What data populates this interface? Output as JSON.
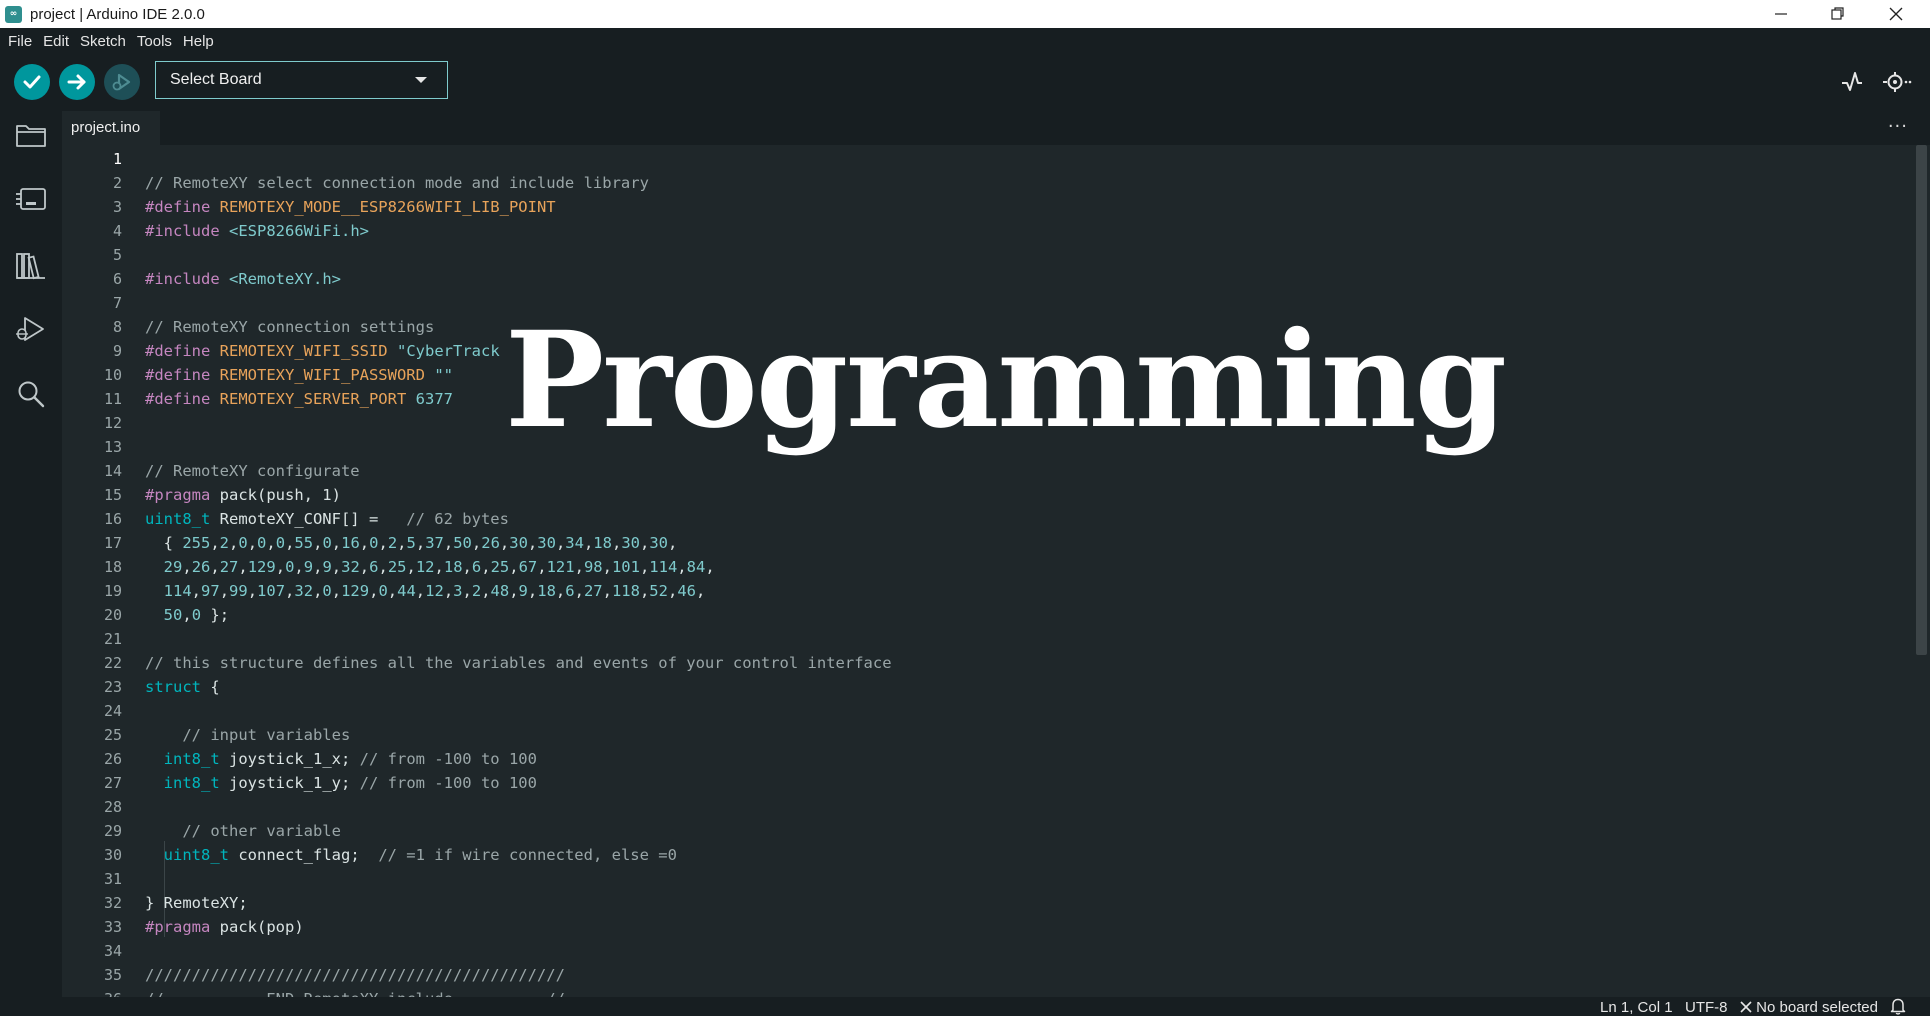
{
  "window": {
    "title": "project | Arduino IDE 2.0.0",
    "app_icon": "∞"
  },
  "menu": [
    "File",
    "Edit",
    "Sketch",
    "Tools",
    "Help"
  ],
  "toolbar": {
    "board_select_label": "Select Board",
    "verify_icon": "check-icon",
    "upload_icon": "arrow-right-icon",
    "debug_icon": "debug-icon",
    "serial_plotter_icon": "plotter-icon",
    "serial_monitor_icon": "monitor-icon"
  },
  "activity_bar": [
    "folder-icon",
    "board-manager-icon",
    "library-icon",
    "debug-run-icon",
    "search-icon"
  ],
  "tabs": [
    {
      "label": "project.ino",
      "active": true
    }
  ],
  "editor": {
    "active_line": 1,
    "lines": [
      [],
      [
        [
          "// RemoteXY select connection mode and include library",
          "cmt"
        ]
      ],
      [
        [
          "#define",
          "kw"
        ],
        [
          " ",
          "plain"
        ],
        [
          "REMOTEXY_MODE__ESP8266WIFI_LIB_POINT",
          "macro"
        ]
      ],
      [
        [
          "#include",
          "kw"
        ],
        [
          " ",
          "plain"
        ],
        [
          "<ESP8266WiFi.h>",
          "str"
        ]
      ],
      [],
      [
        [
          "#include",
          "kw"
        ],
        [
          " ",
          "plain"
        ],
        [
          "<RemoteXY.h>",
          "str"
        ]
      ],
      [],
      [
        [
          "// RemoteXY connection settings",
          "cmt"
        ]
      ],
      [
        [
          "#define",
          "kw"
        ],
        [
          " ",
          "plain"
        ],
        [
          "REMOTEXY_WIFI_SSID",
          "macro"
        ],
        [
          " ",
          "plain"
        ],
        [
          "\"CyberTrack",
          "str"
        ]
      ],
      [
        [
          "#define",
          "kw"
        ],
        [
          " ",
          "plain"
        ],
        [
          "REMOTEXY_WIFI_PASSWORD",
          "macro"
        ],
        [
          " ",
          "plain"
        ],
        [
          "\"\"",
          "str"
        ]
      ],
      [
        [
          "#define",
          "kw"
        ],
        [
          " ",
          "plain"
        ],
        [
          "REMOTEXY_SERVER_PORT",
          "macro"
        ],
        [
          " ",
          "plain"
        ],
        [
          "6377",
          "num"
        ]
      ],
      [],
      [],
      [
        [
          "// RemoteXY configurate",
          "cmt"
        ]
      ],
      [
        [
          "#pragma",
          "kw"
        ],
        [
          " pack(push, 1)",
          "plain"
        ]
      ],
      [
        [
          "uint8_t",
          "type"
        ],
        [
          " RemoteXY_CONF[] =   ",
          "plain"
        ],
        [
          "// 62 bytes",
          "cmt"
        ]
      ],
      [
        [
          "  { ",
          "plain"
        ],
        [
          "255",
          "num"
        ],
        [
          ",",
          "plain"
        ],
        [
          "2",
          "num"
        ],
        [
          ",",
          "plain"
        ],
        [
          "0",
          "num"
        ],
        [
          ",",
          "plain"
        ],
        [
          "0",
          "num"
        ],
        [
          ",",
          "plain"
        ],
        [
          "0",
          "num"
        ],
        [
          ",",
          "plain"
        ],
        [
          "55",
          "num"
        ],
        [
          ",",
          "plain"
        ],
        [
          "0",
          "num"
        ],
        [
          ",",
          "plain"
        ],
        [
          "16",
          "num"
        ],
        [
          ",",
          "plain"
        ],
        [
          "0",
          "num"
        ],
        [
          ",",
          "plain"
        ],
        [
          "2",
          "num"
        ],
        [
          ",",
          "plain"
        ],
        [
          "5",
          "num"
        ],
        [
          ",",
          "plain"
        ],
        [
          "37",
          "num"
        ],
        [
          ",",
          "plain"
        ],
        [
          "50",
          "num"
        ],
        [
          ",",
          "plain"
        ],
        [
          "26",
          "num"
        ],
        [
          ",",
          "plain"
        ],
        [
          "30",
          "num"
        ],
        [
          ",",
          "plain"
        ],
        [
          "30",
          "num"
        ],
        [
          ",",
          "plain"
        ],
        [
          "34",
          "num"
        ],
        [
          ",",
          "plain"
        ],
        [
          "18",
          "num"
        ],
        [
          ",",
          "plain"
        ],
        [
          "30",
          "num"
        ],
        [
          ",",
          "plain"
        ],
        [
          "30",
          "num"
        ],
        [
          ",",
          "plain"
        ]
      ],
      [
        [
          "  ",
          "plain"
        ],
        [
          "29",
          "num"
        ],
        [
          ",",
          "plain"
        ],
        [
          "26",
          "num"
        ],
        [
          ",",
          "plain"
        ],
        [
          "27",
          "num"
        ],
        [
          ",",
          "plain"
        ],
        [
          "129",
          "num"
        ],
        [
          ",",
          "plain"
        ],
        [
          "0",
          "num"
        ],
        [
          ",",
          "plain"
        ],
        [
          "9",
          "num"
        ],
        [
          ",",
          "plain"
        ],
        [
          "9",
          "num"
        ],
        [
          ",",
          "plain"
        ],
        [
          "32",
          "num"
        ],
        [
          ",",
          "plain"
        ],
        [
          "6",
          "num"
        ],
        [
          ",",
          "plain"
        ],
        [
          "25",
          "num"
        ],
        [
          ",",
          "plain"
        ],
        [
          "12",
          "num"
        ],
        [
          ",",
          "plain"
        ],
        [
          "18",
          "num"
        ],
        [
          ",",
          "plain"
        ],
        [
          "6",
          "num"
        ],
        [
          ",",
          "plain"
        ],
        [
          "25",
          "num"
        ],
        [
          ",",
          "plain"
        ],
        [
          "67",
          "num"
        ],
        [
          ",",
          "plain"
        ],
        [
          "121",
          "num"
        ],
        [
          ",",
          "plain"
        ],
        [
          "98",
          "num"
        ],
        [
          ",",
          "plain"
        ],
        [
          "101",
          "num"
        ],
        [
          ",",
          "plain"
        ],
        [
          "114",
          "num"
        ],
        [
          ",",
          "plain"
        ],
        [
          "84",
          "num"
        ],
        [
          ",",
          "plain"
        ]
      ],
      [
        [
          "  ",
          "plain"
        ],
        [
          "114",
          "num"
        ],
        [
          ",",
          "plain"
        ],
        [
          "97",
          "num"
        ],
        [
          ",",
          "plain"
        ],
        [
          "99",
          "num"
        ],
        [
          ",",
          "plain"
        ],
        [
          "107",
          "num"
        ],
        [
          ",",
          "plain"
        ],
        [
          "32",
          "num"
        ],
        [
          ",",
          "plain"
        ],
        [
          "0",
          "num"
        ],
        [
          ",",
          "plain"
        ],
        [
          "129",
          "num"
        ],
        [
          ",",
          "plain"
        ],
        [
          "0",
          "num"
        ],
        [
          ",",
          "plain"
        ],
        [
          "44",
          "num"
        ],
        [
          ",",
          "plain"
        ],
        [
          "12",
          "num"
        ],
        [
          ",",
          "plain"
        ],
        [
          "3",
          "num"
        ],
        [
          ",",
          "plain"
        ],
        [
          "2",
          "num"
        ],
        [
          ",",
          "plain"
        ],
        [
          "48",
          "num"
        ],
        [
          ",",
          "plain"
        ],
        [
          "9",
          "num"
        ],
        [
          ",",
          "plain"
        ],
        [
          "18",
          "num"
        ],
        [
          ",",
          "plain"
        ],
        [
          "6",
          "num"
        ],
        [
          ",",
          "plain"
        ],
        [
          "27",
          "num"
        ],
        [
          ",",
          "plain"
        ],
        [
          "118",
          "num"
        ],
        [
          ",",
          "plain"
        ],
        [
          "52",
          "num"
        ],
        [
          ",",
          "plain"
        ],
        [
          "46",
          "num"
        ],
        [
          ",",
          "plain"
        ]
      ],
      [
        [
          "  ",
          "plain"
        ],
        [
          "50",
          "num"
        ],
        [
          ",",
          "plain"
        ],
        [
          "0",
          "num"
        ],
        [
          " };",
          "plain"
        ]
      ],
      [],
      [
        [
          "// this structure defines all the variables and events of your control interface",
          "cmt"
        ]
      ],
      [
        [
          "struct",
          "type"
        ],
        [
          " {",
          "plain"
        ]
      ],
      [],
      [
        [
          "    // input variables",
          "cmt"
        ]
      ],
      [
        [
          "  ",
          "plain"
        ],
        [
          "int8_t",
          "type"
        ],
        [
          " joystick_1_x; ",
          "plain"
        ],
        [
          "// from -100 to 100",
          "cmt"
        ]
      ],
      [
        [
          "  ",
          "plain"
        ],
        [
          "int8_t",
          "type"
        ],
        [
          " joystick_1_y; ",
          "plain"
        ],
        [
          "// from -100 to 100",
          "cmt"
        ]
      ],
      [],
      [
        [
          "    // other variable",
          "cmt"
        ]
      ],
      [
        [
          "  ",
          "plain"
        ],
        [
          "uint8_t",
          "type"
        ],
        [
          " connect_flag;  ",
          "plain"
        ],
        [
          "// =1 if wire connected, else =0",
          "cmt"
        ]
      ],
      [],
      [
        [
          "} RemoteXY;",
          "plain"
        ]
      ],
      [
        [
          "#pragma",
          "kw"
        ],
        [
          " pack(pop)",
          "plain"
        ]
      ],
      [],
      [
        [
          "/////////////////////////////////////////////",
          "cmt"
        ]
      ],
      [
        [
          "//           END RemoteXY include          //",
          "cmt"
        ]
      ]
    ]
  },
  "overlay": {
    "text": "Programming"
  },
  "status": {
    "position": "Ln 1, Col 1",
    "encoding": "UTF-8",
    "board": "No board selected",
    "board_icon": "close-icon",
    "notifications_icon": "bell-icon"
  },
  "colors": {
    "cmt": "#9aa6a8",
    "kw": "#c586c0",
    "macro": "#e8a35a",
    "str": "#7fcbcd",
    "num": "#7fcbcd",
    "type": "#00b5bd",
    "plain": "#dae3e3",
    "accent": "#00979d"
  }
}
